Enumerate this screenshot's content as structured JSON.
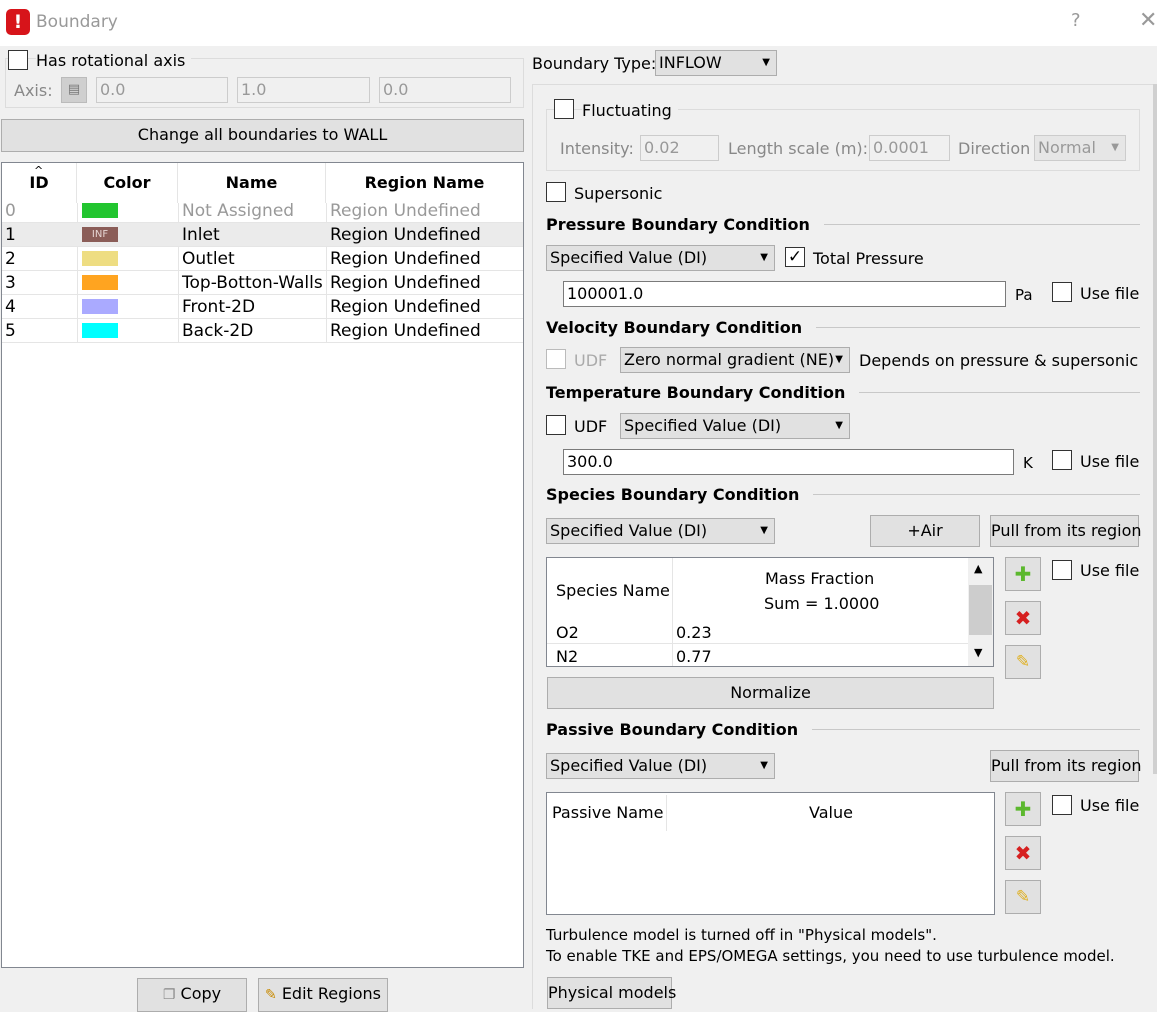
{
  "window": {
    "title": "Boundary",
    "help": "?",
    "close": "✕"
  },
  "rotation": {
    "has_axis_label": "Has rotational axis",
    "axis_label": "Axis:",
    "axis_values": [
      "0.0",
      "1.0",
      "0.0"
    ]
  },
  "change_all_button": "Change all boundaries to WALL",
  "table": {
    "headers": {
      "id": "ID",
      "color": "Color",
      "name": "Name",
      "region": "Region Name"
    },
    "rows": [
      {
        "id": "0",
        "color": "#22c52f",
        "name": "Not Assigned",
        "region": "Region Undefined",
        "disabled": true
      },
      {
        "id": "1",
        "color": "#8b5d58",
        "badge": "INF",
        "name": "Inlet",
        "region": "Region Undefined",
        "selected": true
      },
      {
        "id": "2",
        "color": "#eedd82",
        "name": "Outlet",
        "region": "Region Undefined"
      },
      {
        "id": "3",
        "color": "#ffa420",
        "name": "Top-Botton-Walls",
        "region": "Region Undefined"
      },
      {
        "id": "4",
        "color": "#aaaaff",
        "name": "Front-2D",
        "region": "Region Undefined"
      },
      {
        "id": "5",
        "color": "#00ffff",
        "name": "Back-2D",
        "region": "Region Undefined"
      }
    ]
  },
  "bottom_buttons": {
    "copy": "Copy",
    "edit_regions": "Edit Regions"
  },
  "boundary_type": {
    "label": "Boundary Type:",
    "value": "INFLOW"
  },
  "fluctuating": {
    "label": "Fluctuating",
    "intensity_label": "Intensity:",
    "intensity_value": "0.02",
    "length_label": "Length scale (m):",
    "length_value": "0.0001",
    "direction_label": "Direction",
    "direction_value": "Normal"
  },
  "supersonic_label": "Supersonic",
  "pressure": {
    "title": "Pressure Boundary Condition",
    "mode": "Specified Value (DI)",
    "total_label": "Total Pressure",
    "total_checked": "✓",
    "value": "100001.0",
    "unit": "Pa",
    "use_file": "Use file"
  },
  "velocity": {
    "title": "Velocity Boundary Condition",
    "udf": "UDF",
    "mode": "Zero normal gradient (NE)",
    "note": "Depends on pressure & supersonic"
  },
  "temperature": {
    "title": "Temperature Boundary Condition",
    "udf": "UDF",
    "mode": "Specified Value (DI)",
    "value": "300.0",
    "unit": "K",
    "use_file": "Use file"
  },
  "species": {
    "title": "Species Boundary Condition",
    "mode": "Specified Value (DI)",
    "air_button": "+Air",
    "pull_button": "Pull from its region",
    "col_name": "Species Name",
    "col_fraction": "Mass Fraction",
    "col_sum": "Sum = 1.0000",
    "rows": [
      {
        "name": "O2",
        "value": "0.23"
      },
      {
        "name": "N2",
        "value": "0.77"
      }
    ],
    "use_file": "Use file",
    "normalize": "Normalize"
  },
  "passive": {
    "title": "Passive Boundary Condition",
    "mode": "Specified Value (DI)",
    "pull_button": "Pull from its region",
    "col_name": "Passive Name",
    "col_value": "Value",
    "use_file": "Use file"
  },
  "turbulence_note": {
    "line1": "Turbulence model is turned off in \"Physical models\".",
    "line2": "To enable TKE and EPS/OMEGA settings, you need to use turbulence model."
  },
  "physical_models_button": "Physical models",
  "colors": {
    "add": "#5cb82e",
    "remove": "#d62020",
    "clear": "#e0b020"
  }
}
